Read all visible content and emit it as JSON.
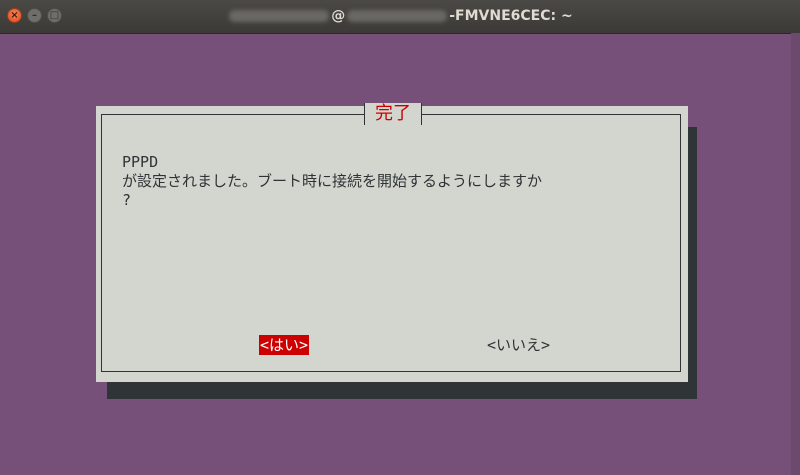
{
  "window": {
    "title_at": "@",
    "title_host": "-FMVNE6CEC: ~",
    "buttons": {
      "close": "×",
      "minimize": "–",
      "maximize": "□"
    }
  },
  "dialog": {
    "title": "完了",
    "line1": "PPPD",
    "line2": "が設定されました。ブート時に接続を開始するようにしますか",
    "line3": "?",
    "yes_label": "<はい>",
    "no_label": "<いいえ>"
  },
  "colors": {
    "background": "#77507a",
    "dialog": "#d3d6cf",
    "shadow": "#2f3436",
    "accent": "#cc0000",
    "text": "#2e3436"
  }
}
